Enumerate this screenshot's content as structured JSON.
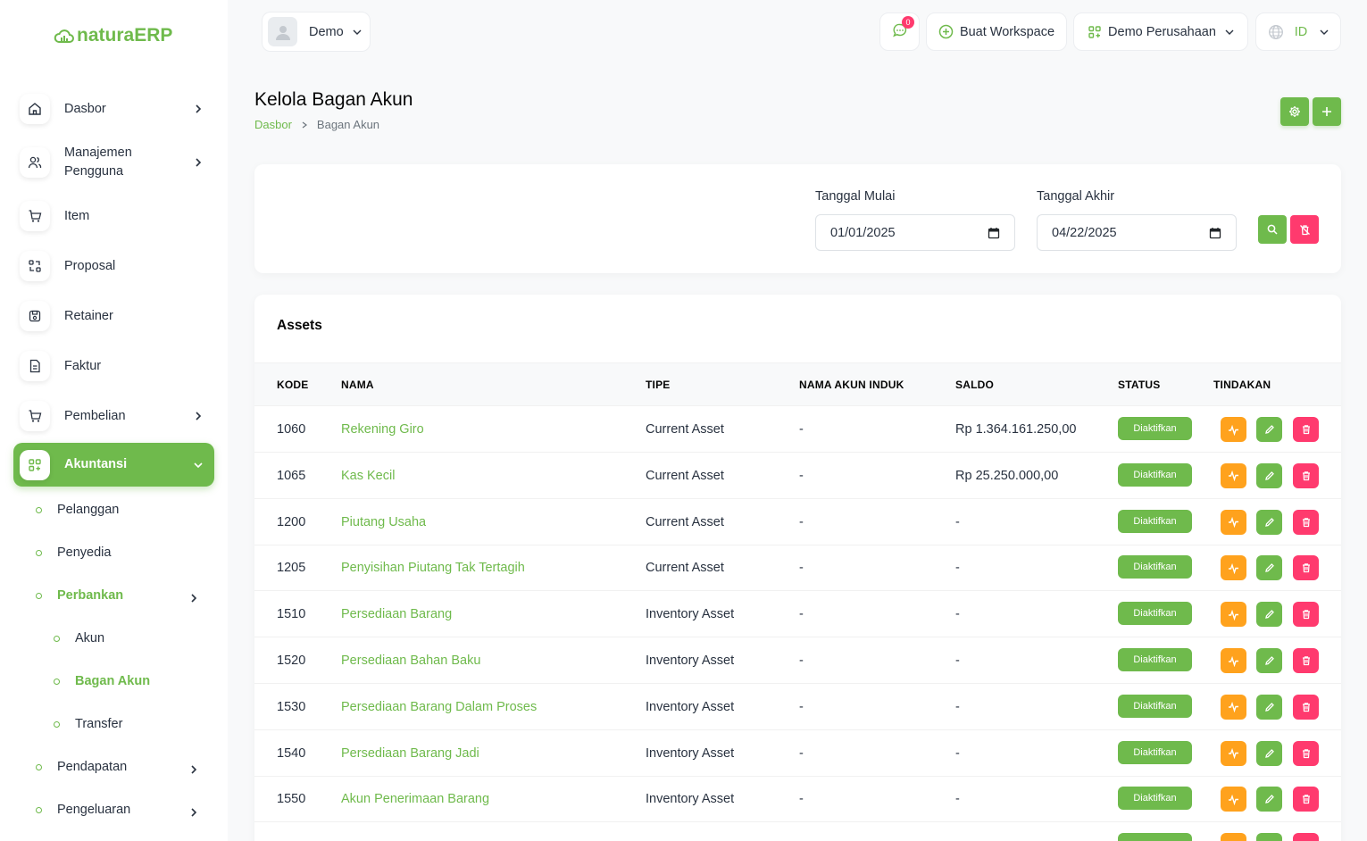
{
  "brand": {
    "name_part1": "natura",
    "name_part2": "ERP"
  },
  "header": {
    "user_name": "Demo",
    "message_count": "0",
    "create_workspace": "Buat Workspace",
    "company": "Demo Perusahaan",
    "language": "ID"
  },
  "sidebar": {
    "items": [
      {
        "label": "Dasbor",
        "icon": "home-icon"
      },
      {
        "label": "Manajemen Pengguna",
        "icon": "users-icon"
      },
      {
        "label": "Item",
        "icon": "cart-icon"
      },
      {
        "label": "Proposal",
        "icon": "swap-icon"
      },
      {
        "label": "Retainer",
        "icon": "save-icon"
      },
      {
        "label": "Faktur",
        "icon": "file-icon"
      },
      {
        "label": "Pembelian",
        "icon": "cart-icon"
      },
      {
        "label": "Akuntansi",
        "icon": "grid-plus-icon"
      }
    ],
    "sub_items": [
      "Pelanggan",
      "Penyedia",
      "Perbankan"
    ],
    "sub_sub_items": [
      "Akun",
      "Bagan Akun",
      "Transfer"
    ],
    "more_items": [
      "Pendapatan",
      "Pengeluaran"
    ]
  },
  "page": {
    "title": "Kelola Bagan Akun",
    "breadcrumb_home": "Dasbor",
    "breadcrumb_current": "Bagan Akun"
  },
  "filter": {
    "start_label": "Tanggal Mulai",
    "start_value": "01/01/2025",
    "end_label": "Tanggal Akhir",
    "end_value": "04/22/2025"
  },
  "table": {
    "title": "Assets",
    "columns": [
      "KODE",
      "NAMA",
      "TIPE",
      "NAMA AKUN INDUK",
      "SALDO",
      "STATUS",
      "TINDAKAN"
    ],
    "rows": [
      {
        "code": "1060",
        "name": "Rekening Giro",
        "type": "Current Asset",
        "parent": "-",
        "balance": "Rp 1.364.161.250,00",
        "status": "Diaktifkan"
      },
      {
        "code": "1065",
        "name": "Kas Kecil",
        "type": "Current Asset",
        "parent": "-",
        "balance": "Rp 25.250.000,00",
        "status": "Diaktifkan"
      },
      {
        "code": "1200",
        "name": "Piutang Usaha",
        "type": "Current Asset",
        "parent": "-",
        "balance": "-",
        "status": "Diaktifkan"
      },
      {
        "code": "1205",
        "name": "Penyisihan Piutang Tak Tertagih",
        "type": "Current Asset",
        "parent": "-",
        "balance": "-",
        "status": "Diaktifkan"
      },
      {
        "code": "1510",
        "name": "Persediaan Barang",
        "type": "Inventory Asset",
        "parent": "-",
        "balance": "-",
        "status": "Diaktifkan"
      },
      {
        "code": "1520",
        "name": "Persediaan Bahan Baku",
        "type": "Inventory Asset",
        "parent": "-",
        "balance": "-",
        "status": "Diaktifkan"
      },
      {
        "code": "1530",
        "name": "Persediaan Barang Dalam Proses",
        "type": "Inventory Asset",
        "parent": "-",
        "balance": "-",
        "status": "Diaktifkan"
      },
      {
        "code": "1540",
        "name": "Persediaan Barang Jadi",
        "type": "Inventory Asset",
        "parent": "-",
        "balance": "-",
        "status": "Diaktifkan"
      },
      {
        "code": "1550",
        "name": "Akun Penerimaan Barang",
        "type": "Inventory Asset",
        "parent": "-",
        "balance": "-",
        "status": "Diaktifkan"
      }
    ]
  },
  "colors": {
    "primary": "#6fba4c",
    "warning": "#ffa21d",
    "danger": "#ff3a6e"
  }
}
